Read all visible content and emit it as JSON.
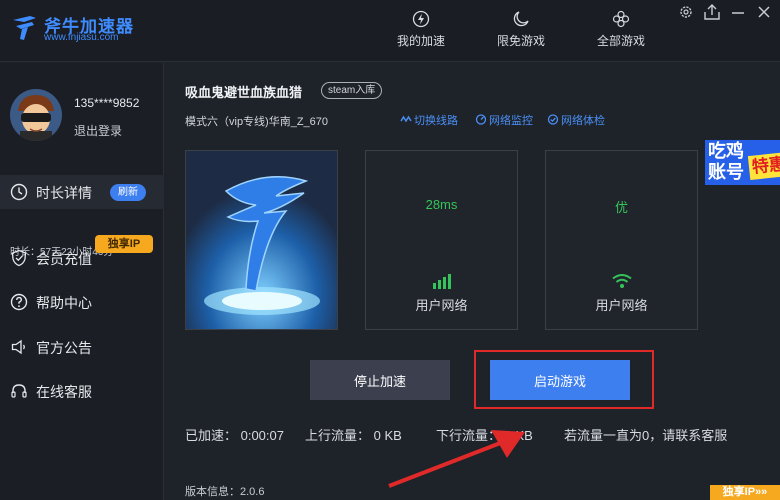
{
  "app": {
    "name": "斧牛加速器",
    "url": "www.fnjiasu.com",
    "brand_color": "#3f8cff"
  },
  "nav": [
    {
      "label": "我的加速",
      "icon": "lightning-icon"
    },
    {
      "label": "限免游戏",
      "icon": "moon-icon"
    },
    {
      "label": "全部游戏",
      "icon": "flower-icon"
    }
  ],
  "window_controls": [
    "settings-icon",
    "upload-icon",
    "minimize-icon",
    "close-icon"
  ],
  "user": {
    "phone": "135****9852",
    "logout": "退出登录"
  },
  "sidebar": {
    "items": [
      {
        "label": "时长详情",
        "icon": "clock-icon",
        "active": true
      },
      {
        "label": "会员充值",
        "icon": "shield-icon"
      },
      {
        "label": "帮助中心",
        "icon": "help-icon"
      },
      {
        "label": "官方公告",
        "icon": "speaker-icon"
      },
      {
        "label": "在线客服",
        "icon": "headset-icon"
      }
    ],
    "refresh_badge": "刷新",
    "remaining_time": "时长：57天22小时46分",
    "exclusive_ip_badge": "独享IP"
  },
  "game": {
    "title": "吸血鬼避世血族血猎",
    "tag": "steam入库",
    "mode": "模式六（vip专线)华南_Z_670",
    "actions": [
      "切换线路",
      "网络监控",
      "网络体检"
    ]
  },
  "cards": [
    {
      "value": "28ms",
      "label": "用户网络",
      "icon": "signal-bars-icon"
    },
    {
      "value": "优",
      "label": "用户网络",
      "icon": "wifi-icon"
    }
  ],
  "ad": {
    "line1": "吃鸡",
    "line2": "账号",
    "tag": "特惠"
  },
  "buttons": {
    "stop": "停止加速",
    "start": "启动游戏"
  },
  "stats": {
    "accelerated": "已加速：  0:00:07",
    "upload": "上行流量：  0 KB",
    "download": "下行流量：  0 KB",
    "hint": "若流量一直为0，请联系客服"
  },
  "version": "版本信息：2.0.6",
  "ip_banner": "独享IP»»",
  "colors": {
    "accent": "#3e7ff0",
    "good": "#35c45a",
    "highlight": "#e02a2a",
    "badge": "#f6a91e"
  }
}
